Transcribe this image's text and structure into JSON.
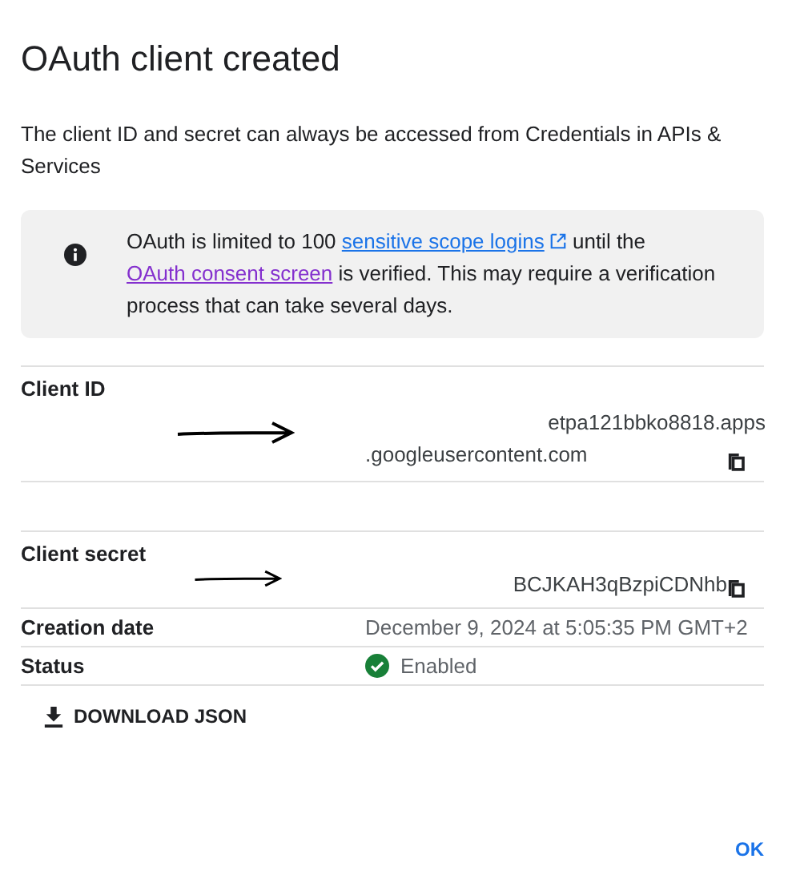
{
  "dialog": {
    "title": "OAuth client created",
    "description": "The client ID and secret can always be accessed from Credentials in APIs & Services"
  },
  "notice": {
    "before": "OAuth is limited to 100 ",
    "link1": "sensitive scope logins",
    "middle": " until the ",
    "link2": "OAuth consent screen",
    "after": " is verified. This may require a verification process that can take several days."
  },
  "details": [
    {
      "kind": "copy",
      "label": "Client ID",
      "lines": [
        "etpa121bbko8818.apps",
        ".googleusercontent.com"
      ]
    },
    {
      "kind": "copy",
      "label": "Client secret",
      "lines": [
        "BCJKAH3qBzpiCDNhb"
      ]
    },
    {
      "kind": "text",
      "label": "Creation date",
      "value": "December 9, 2024 at 5:05:35 PM GMT+2"
    },
    {
      "kind": "status",
      "label": "Status",
      "value": "Enabled",
      "enabled": true
    }
  ],
  "download_button": "DOWNLOAD JSON",
  "ok_button": "OK"
}
